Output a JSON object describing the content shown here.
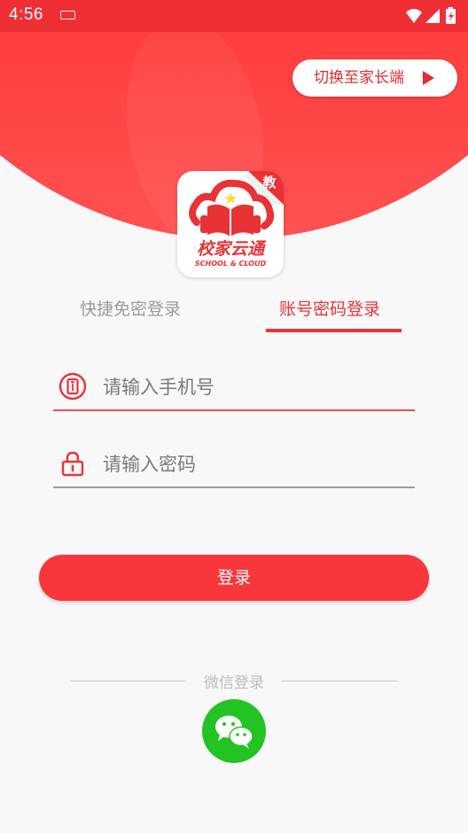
{
  "status_bar": {
    "time": "4:56",
    "icons": [
      "keyboard-icon",
      "wifi-icon",
      "signal-icon",
      "battery-charging-icon"
    ]
  },
  "header": {
    "switch_label": "切换至家长端",
    "switch_icon": "play-arrow-icon"
  },
  "logo": {
    "badge": "教",
    "name": "校家云通",
    "subtitle": "SCHOOL & CLOUD"
  },
  "tabs": [
    {
      "label": "快捷免密登录",
      "active": false
    },
    {
      "label": "账号密码登录",
      "active": true
    }
  ],
  "form": {
    "phone": {
      "placeholder": "请输入手机号",
      "value": "",
      "icon": "phone-icon"
    },
    "password": {
      "placeholder": "请输入密码",
      "value": "",
      "icon": "lock-icon"
    },
    "login_label": "登录"
  },
  "wechat": {
    "label": "微信登录",
    "icon": "wechat-icon"
  },
  "colors": {
    "brand_red": "#f8373c",
    "tab_active": "#e8343a",
    "wechat_green": "#22c322"
  }
}
